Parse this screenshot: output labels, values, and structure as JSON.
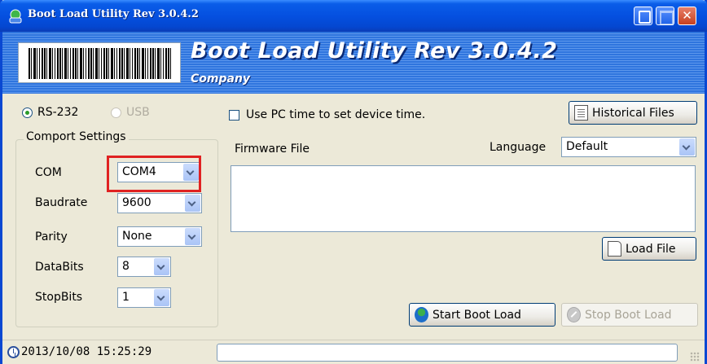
{
  "window": {
    "title": "Boot Load Utility Rev 3.0.4.2"
  },
  "banner": {
    "title": "Boot Load Utility Rev 3.0.4.2",
    "company": "Company"
  },
  "interface": {
    "rs232_label": "RS-232",
    "usb_label": "USB",
    "selected": "RS-232"
  },
  "comport": {
    "group_label": "Comport Settings",
    "com_label": "COM",
    "com_value": "COM4",
    "baudrate_label": "Baudrate",
    "baudrate_value": "9600",
    "parity_label": "Parity",
    "parity_value": "None",
    "databits_label": "DataBits",
    "databits_value": "8",
    "stopbits_label": "StopBits",
    "stopbits_value": "1"
  },
  "options": {
    "use_pc_time_label": "Use PC time to set device time.",
    "use_pc_time_checked": false
  },
  "buttons": {
    "historical_files": "Historical Files",
    "load_file": "Load File",
    "start_boot_load": "Start Boot Load",
    "stop_boot_load": "Stop Boot Load"
  },
  "firmware": {
    "label": "Firmware File",
    "value": ""
  },
  "language": {
    "label": "Language",
    "value": "Default"
  },
  "status": {
    "timestamp": "2013/10/08 15:25:29",
    "progress": 0
  },
  "colors": {
    "titlebar": "#0550e0",
    "banner": "#2f75de",
    "highlight": "#e02222",
    "window_bg": "#ece9d8"
  },
  "icons": [
    "app-icon",
    "minimize-icon",
    "maximize-icon",
    "close-icon",
    "document-icon",
    "file-icon",
    "boot-icon",
    "stop-icon",
    "clock-icon"
  ]
}
